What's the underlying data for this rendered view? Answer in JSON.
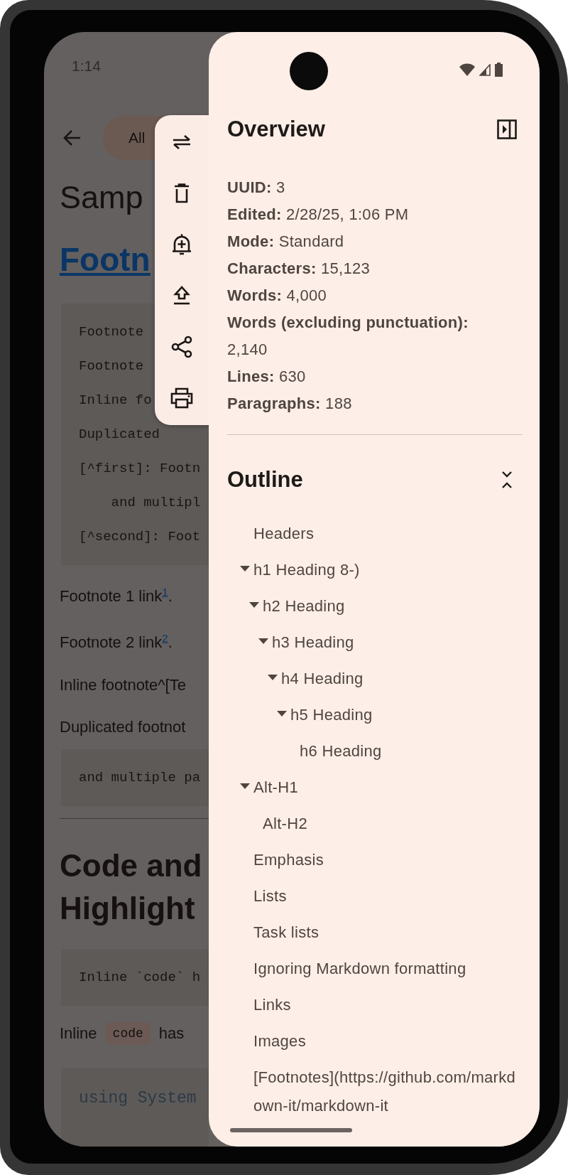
{
  "status_bar": {
    "time": "1:14"
  },
  "document": {
    "filter_chip": "All",
    "blocks": [
      {
        "kind": "title",
        "text": "Samp"
      },
      {
        "kind": "link_heading",
        "text": "Footn"
      },
      {
        "kind": "code",
        "lines": [
          "Footnote",
          "Footnote",
          "Inline fo",
          "Duplicated",
          "[^first]: Footn",
          "    and multipl",
          "[^second]: Foot"
        ]
      },
      {
        "kind": "paragraph",
        "text": "Footnote 1 link$^{1}$."
      },
      {
        "kind": "paragraph",
        "text": "Footnote 2 link$^{2}$."
      },
      {
        "kind": "paragraph",
        "text": "Inline footnote^[Te"
      },
      {
        "kind": "paragraph",
        "text": "Duplicated footnot"
      },
      {
        "kind": "code",
        "lines": [
          "and multiple pa"
        ]
      },
      {
        "kind": "rule"
      },
      {
        "kind": "heading",
        "text": "Code and Highlight"
      },
      {
        "kind": "code",
        "lines": [
          "Inline `code` h"
        ]
      },
      {
        "kind": "inline",
        "parts": [
          {
            "kind": "text",
            "text": "Inline"
          },
          {
            "kind": "code",
            "text": "code"
          },
          {
            "kind": "text",
            "text": "has"
          }
        ]
      },
      {
        "kind": "highlighted_code",
        "lines": [
          "using System"
        ]
      }
    ]
  },
  "drawer": {
    "overview": {
      "title": "Overview",
      "stats": [
        "**UUID:** 3",
        "**Edited:** 2/28/25, 1:06 PM",
        "**Mode:** Standard",
        "**Characters:** 15,123",
        "**Words:** 4,000",
        "**Words (excluding punctuation):** 2,140",
        "**Lines:** 630",
        "**Paragraphs:** 188"
      ]
    },
    "outline": {
      "title": "Outline",
      "items": [
        {
          "text": "Headers"
        },
        {
          "text": "h1 Heading 8-)",
          "expanded": true,
          "children": [
            {
              "text": "h2 Heading",
              "expanded": true,
              "children": [
                {
                  "text": "h3 Heading",
                  "expanded": true,
                  "children": [
                    {
                      "text": "h4 Heading",
                      "expanded": true,
                      "children": [
                        {
                          "text": "h5 Heading",
                          "expanded": true,
                          "children": [
                            {
                              "text": "h6 Heading"
                            }
                          ]
                        }
                      ]
                    }
                  ]
                }
              ]
            }
          ]
        },
        {
          "text": "Alt-H1",
          "expanded": true,
          "children": [
            {
              "text": "Alt-H2"
            }
          ]
        },
        {
          "text": "Emphasis"
        },
        {
          "text": "Lists"
        },
        {
          "text": "Task lists"
        },
        {
          "text": "Ignoring Markdown formatting"
        },
        {
          "text": "Links"
        },
        {
          "text": "Images"
        },
        {
          "text": "[Footnotes](https://github.com/markdown-it/markdown-it"
        }
      ]
    }
  }
}
